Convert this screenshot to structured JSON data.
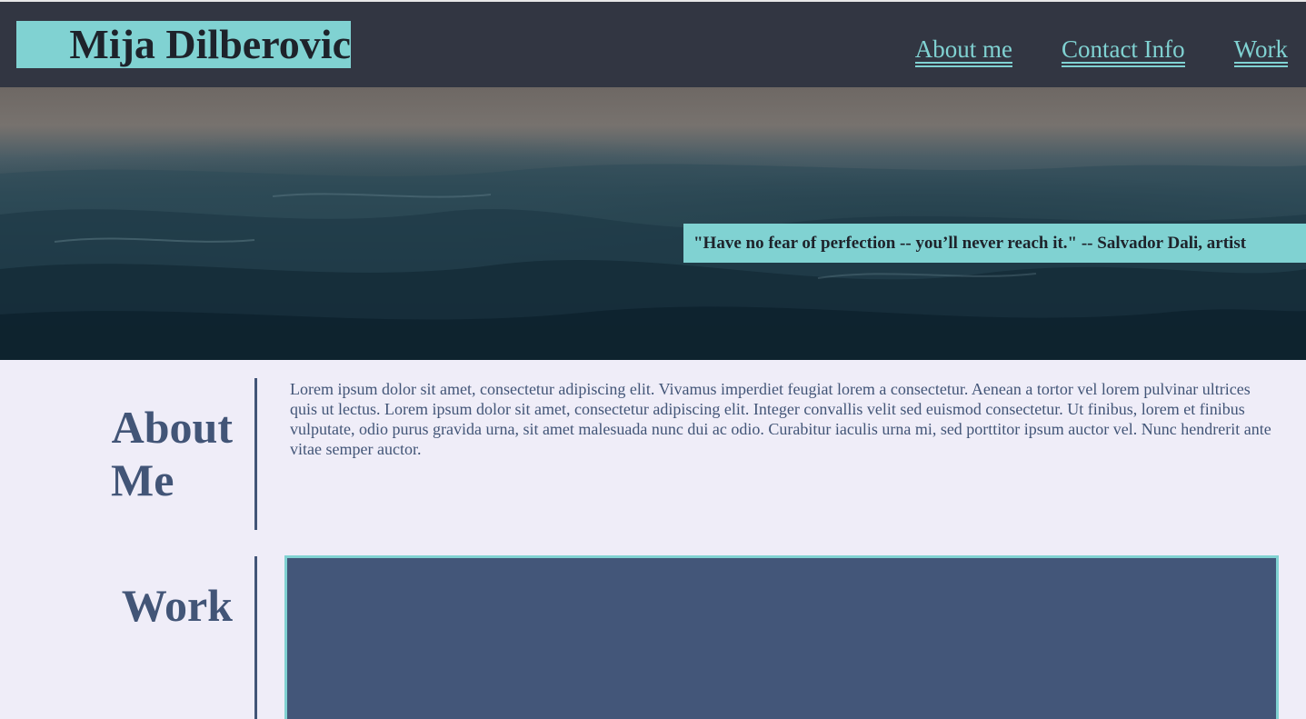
{
  "header": {
    "title": "Mija Dilberovic",
    "nav": [
      "About me",
      "Contact Info",
      "Work"
    ]
  },
  "hero": {
    "quote": "\"Have no fear of perfection -- you’ll never reach it.\" -- Salvador Dali, artist"
  },
  "about": {
    "title_line1": "About",
    "title_line2": "Me",
    "text": "Lorem ipsum dolor sit amet, consectetur adipiscing elit. Vivamus imperdiet feugiat lorem a consectetur. Aenean a tortor vel lorem pulvinar ultrices quis ut lectus. Lorem ipsum dolor sit amet, consectetur adipiscing elit. Integer convallis velit sed euismod consectetur. Ut finibus, lorem et finibus vulputate, odio purus gravida urna, sit amet malesuada nunc dui ac odio. Curabitur iaculis urna mi, sed porttitor ipsum auctor vel. Nunc hendrerit ante vitae semper auctor."
  },
  "work": {
    "title": "Work"
  },
  "colors": {
    "header_bg": "#323642",
    "accent": "#80d2d2",
    "text_primary": "#425577",
    "page_bg": "#efedf8",
    "work_box": "#435679"
  }
}
